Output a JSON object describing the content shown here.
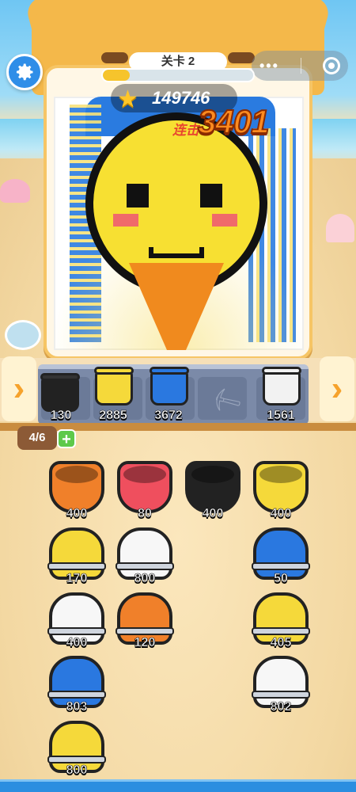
{
  "header": {
    "level_label": "关卡 2",
    "level_progress_fraction": 0.18,
    "score": "149746",
    "combo_label": "连击",
    "combo_value": "3401"
  },
  "icons": {
    "settings": "gear-icon",
    "more": "more-dots-icon",
    "close": "target-circle-icon",
    "score": "star-icon",
    "arrow_left": "chevron-left-icon",
    "arrow_right": "chevron-right-icon",
    "shovel": "shovel-icon",
    "add": "plus-icon"
  },
  "conveyor": {
    "slots": [
      {
        "color": "#222222",
        "count": "130"
      },
      {
        "color": "#f5d93a",
        "count": "2885"
      },
      {
        "color": "#2a78e0",
        "count": "3672"
      },
      {
        "color": "shovel",
        "count": ""
      },
      {
        "color": "#f2f2f2",
        "count": "1561"
      }
    ]
  },
  "slots_counter": {
    "text": "4/6",
    "plus": "+"
  },
  "buckets": {
    "row1": [
      {
        "color": "#f0802a",
        "count": "400"
      },
      {
        "color": "#ef4f5e",
        "count": "80"
      },
      {
        "color": "#222222",
        "count": "400"
      },
      {
        "color": "#f5d93a",
        "count": "400"
      }
    ],
    "grid": [
      {
        "color": "#f5d93a",
        "count": "170"
      },
      {
        "color": "#f7f7f7",
        "count": "800"
      },
      {
        "color": "#2a78e0",
        "count": "50"
      },
      {
        "color": "#f7f7f7",
        "count": "400"
      },
      {
        "color": "#f0802a",
        "count": "120"
      },
      {
        "color": "#f5d93a",
        "count": "405"
      },
      {
        "color": "#2a78e0",
        "count": "803"
      },
      {
        "color": "#f7f7f7",
        "count": "802"
      },
      {
        "color": "#f5d93a",
        "count": "800"
      }
    ]
  }
}
